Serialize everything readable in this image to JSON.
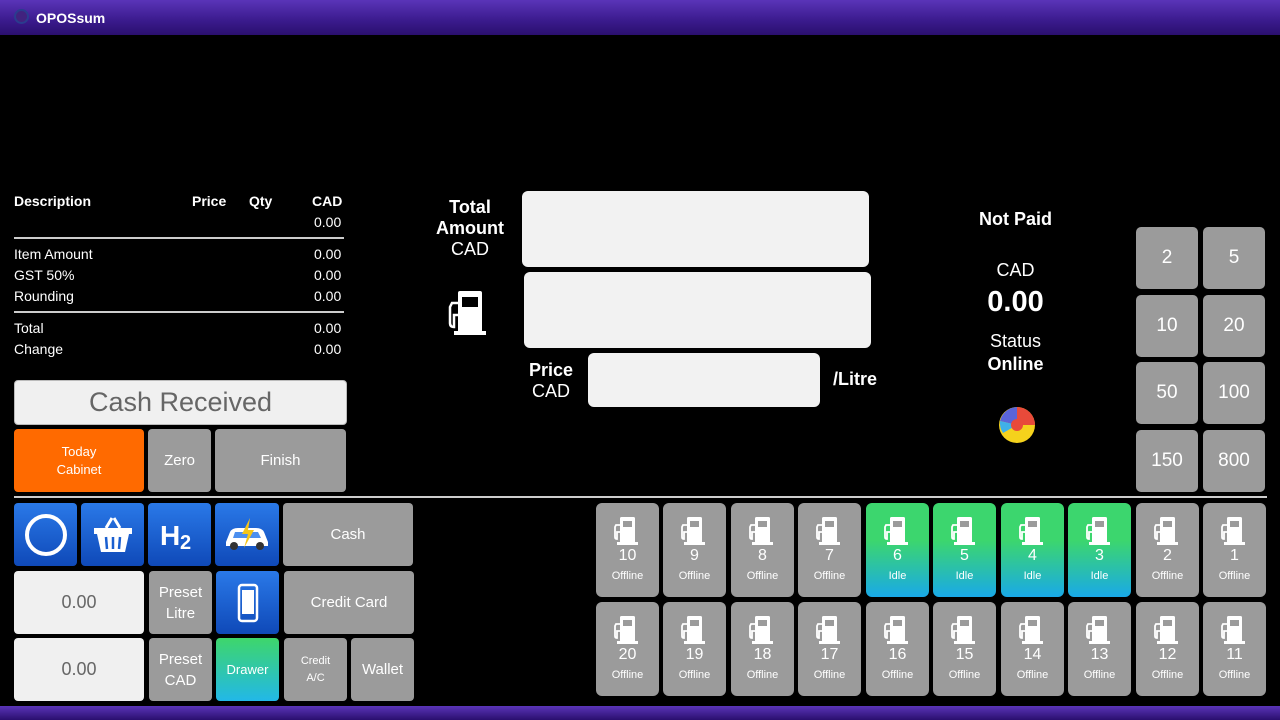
{
  "app": {
    "title": "OPOSsum"
  },
  "receipt": {
    "headers": {
      "description": "Description",
      "price": "Price",
      "qty": "Qty",
      "cad": "CAD"
    },
    "first_total": "0.00",
    "lines": [
      {
        "label": "Item Amount",
        "value": "0.00"
      },
      {
        "label": "GST 50%",
        "value": "0.00"
      },
      {
        "label": "Rounding",
        "value": "0.00"
      }
    ],
    "totals": [
      {
        "label": "Total",
        "value": "0.00"
      },
      {
        "label": "Change",
        "value": "0.00"
      }
    ]
  },
  "cash_received": {
    "label": "Cash Received"
  },
  "actions": {
    "today_cabinet_line1": "Today",
    "today_cabinet_line2": "Cabinet",
    "zero": "Zero",
    "finish": "Finish"
  },
  "center": {
    "total_amount_line1": "Total",
    "total_amount_line2": "Amount",
    "total_amount_line3": "CAD",
    "price_line1": "Price",
    "price_line2": "CAD",
    "per_litre": "/Litre"
  },
  "status": {
    "payment_status": "Not Paid",
    "currency": "CAD",
    "amount": "0.00",
    "status_label": "Status",
    "status_value": "Online"
  },
  "quick_amounts": [
    "2",
    "5",
    "10",
    "20",
    "50",
    "100",
    "150",
    "800"
  ],
  "tools": {
    "cash": "Cash",
    "credit_card": "Credit Card",
    "preset_litre_line1": "Preset",
    "preset_litre_line2": "Litre",
    "preset_cad_line1": "Preset",
    "preset_cad_line2": "CAD",
    "drawer": "Drawer",
    "credit_ac_line1": "Credit",
    "credit_ac_line2": "A/C",
    "wallet": "Wallet",
    "input1_value": "0.00",
    "input2_value": "0.00"
  },
  "pumps_row1": [
    {
      "num": "10",
      "status": "Offline",
      "state": "off"
    },
    {
      "num": "9",
      "status": "Offline",
      "state": "off"
    },
    {
      "num": "8",
      "status": "Offline",
      "state": "off"
    },
    {
      "num": "7",
      "status": "Offline",
      "state": "off"
    },
    {
      "num": "6",
      "status": "Idle",
      "state": "idle"
    },
    {
      "num": "5",
      "status": "Idle",
      "state": "idle"
    },
    {
      "num": "4",
      "status": "Idle",
      "state": "idle"
    },
    {
      "num": "3",
      "status": "Idle",
      "state": "idle"
    },
    {
      "num": "2",
      "status": "Offline",
      "state": "off"
    },
    {
      "num": "1",
      "status": "Offline",
      "state": "off"
    }
  ],
  "pumps_row2": [
    {
      "num": "20",
      "status": "Offline",
      "state": "off"
    },
    {
      "num": "19",
      "status": "Offline",
      "state": "off"
    },
    {
      "num": "18",
      "status": "Offline",
      "state": "off"
    },
    {
      "num": "17",
      "status": "Offline",
      "state": "off"
    },
    {
      "num": "16",
      "status": "Offline",
      "state": "off"
    },
    {
      "num": "15",
      "status": "Offline",
      "state": "off"
    },
    {
      "num": "14",
      "status": "Offline",
      "state": "off"
    },
    {
      "num": "13",
      "status": "Offline",
      "state": "off"
    },
    {
      "num": "12",
      "status": "Offline",
      "state": "off"
    },
    {
      "num": "11",
      "status": "Offline",
      "state": "off"
    }
  ],
  "icons": {
    "app": "app-logo-icon",
    "pump": "fuel-pump-icon",
    "circle": "circle-icon",
    "basket": "basket-icon",
    "hydrogen": "h2-icon",
    "ev": "ev-car-icon",
    "phone": "phone-icon",
    "brand": "brand-logo-icon"
  }
}
